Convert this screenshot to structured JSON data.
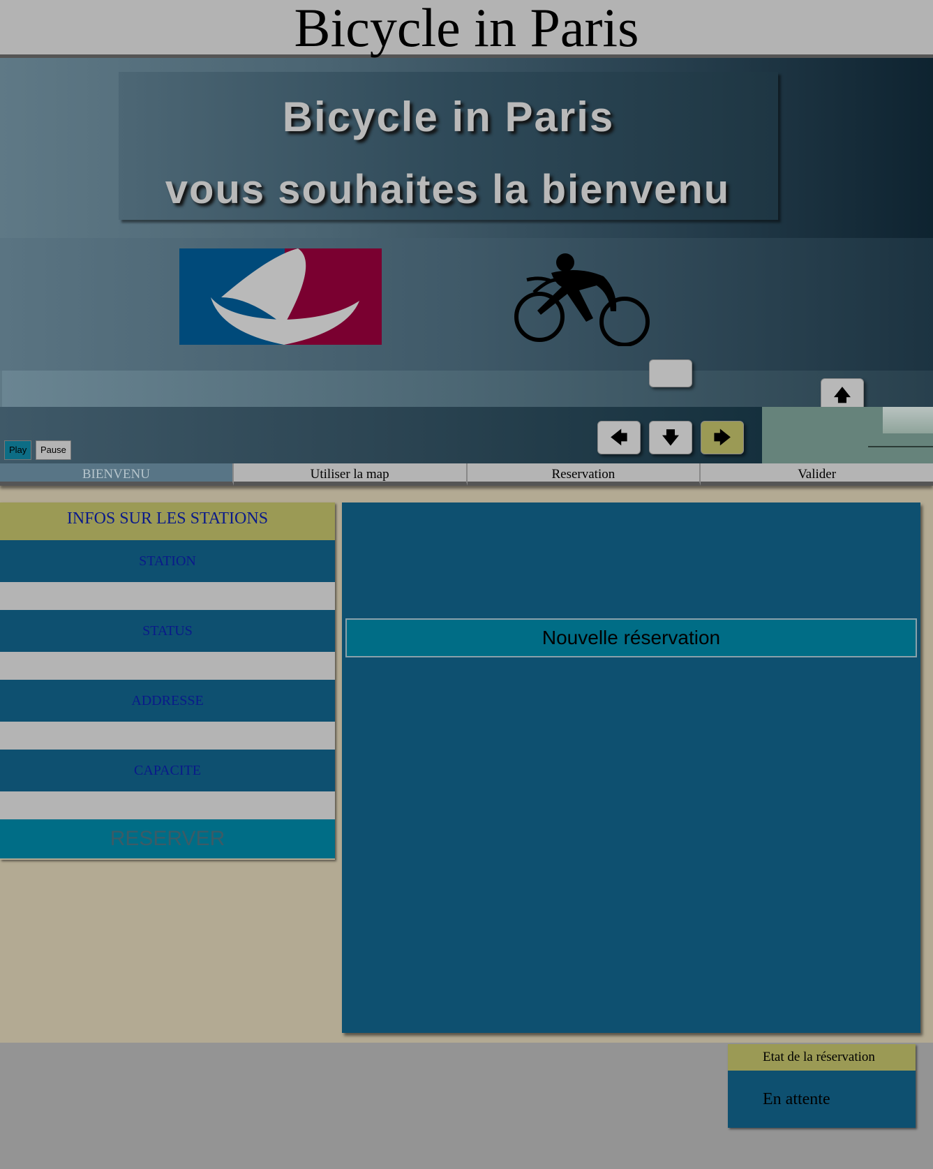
{
  "header": {
    "title": "Bicycle in Paris"
  },
  "slider": {
    "welcome_line1": "Bicycle in Paris",
    "welcome_line2": "vous souhaites la bienvenu",
    "nav": {
      "up": "🡅",
      "left": "🡄",
      "down": "🡇",
      "right": "🡆"
    },
    "play_label": "Play",
    "pause_label": "Pause"
  },
  "tabs": [
    {
      "label": "BIENVENU",
      "active": true
    },
    {
      "label": "Utiliser la map"
    },
    {
      "label": "Reservation"
    },
    {
      "label": "Valider"
    }
  ],
  "stations": {
    "title": "INFOS SUR LES STATIONS",
    "fields": [
      {
        "label": "STATION",
        "value": ""
      },
      {
        "label": "STATUS",
        "value": ""
      },
      {
        "label": "ADDRESSE",
        "value": ""
      },
      {
        "label": "CAPACITE",
        "value": ""
      }
    ],
    "reserve_label": "RESERVER"
  },
  "map": {
    "new_reservation_label": "Nouvelle réservation"
  },
  "reservation_status": {
    "title": "Etat de la réservation",
    "value": "En attente"
  },
  "colors": {
    "accent_olive": "#9b9a55",
    "panel_blue": "#0e5070",
    "button_teal": "#006d86",
    "page_bg": "#b3aa93"
  }
}
